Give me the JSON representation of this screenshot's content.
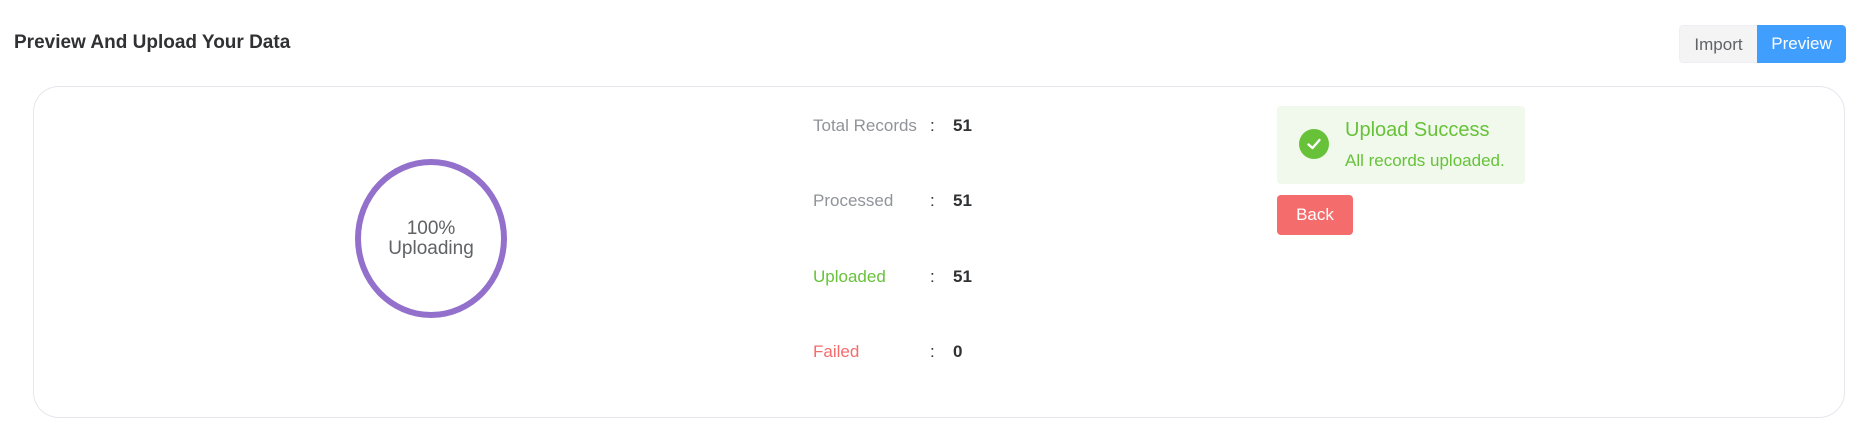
{
  "header": {
    "title": "Preview And Upload Your Data",
    "tabs": [
      {
        "label": "Import",
        "active": false
      },
      {
        "label": "Preview",
        "active": true
      }
    ]
  },
  "progress": {
    "percent_label": "100%",
    "percent": 100,
    "status_label": "Uploading",
    "ring_color": "#9370cc"
  },
  "stats": [
    {
      "label": "Total Records",
      "separator": ":",
      "value": "51",
      "tone": "muted"
    },
    {
      "label": "Processed",
      "separator": ":",
      "value": "51",
      "tone": "muted"
    },
    {
      "label": "Uploaded",
      "separator": ":",
      "value": "51",
      "tone": "success"
    },
    {
      "label": "Failed",
      "separator": ":",
      "value": "0",
      "tone": "danger"
    }
  ],
  "alert": {
    "type": "success",
    "icon": "check-circle-icon",
    "title": "Upload Success",
    "description": "All records uploaded."
  },
  "actions": {
    "back_label": "Back"
  },
  "colors": {
    "primary": "#409eff",
    "success": "#67c23a",
    "danger": "#f56c6c",
    "muted": "#909399"
  }
}
